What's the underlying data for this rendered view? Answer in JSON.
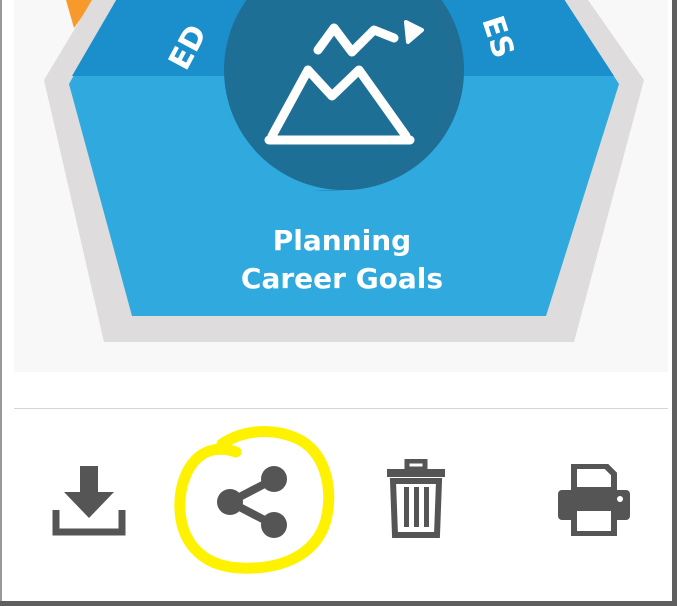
{
  "badge": {
    "title_line1": "Planning",
    "title_line2": "Career Goals",
    "arc_left": "ED",
    "arc_right": "ES"
  },
  "colors": {
    "hex_outer": "#dedcdc",
    "hex_fill": "#2fa9de",
    "hex_top": "#1a8fcb",
    "circle": "#1e6f95",
    "icon_gray": "#555555",
    "highlight": "#fff200",
    "accent_orange": "#f79a2b"
  },
  "toolbar": {
    "download": {
      "icon": "download-icon"
    },
    "share": {
      "icon": "share-icon",
      "highlighted": true
    },
    "delete": {
      "icon": "trash-icon"
    },
    "print": {
      "icon": "printer-icon"
    }
  }
}
